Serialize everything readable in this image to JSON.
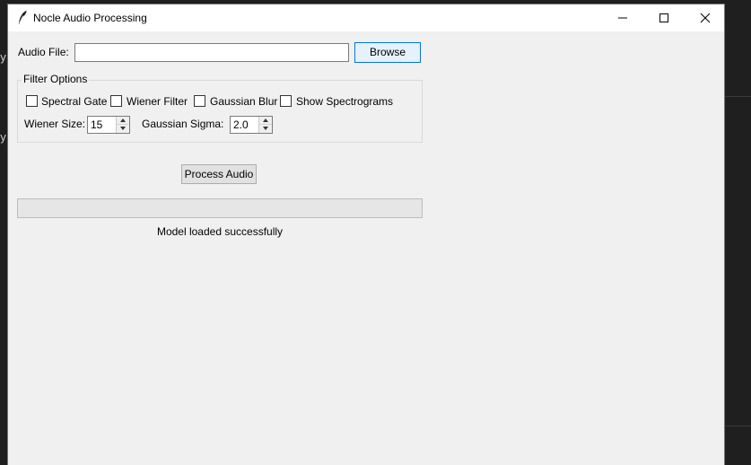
{
  "window": {
    "title": "Nocle Audio Processing",
    "icon": "feather-icon"
  },
  "titlebar_buttons": {
    "minimize": "minimize-icon",
    "maximize": "maximize-icon",
    "close": "close-icon"
  },
  "audio_file": {
    "label": "Audio File:",
    "value": "",
    "browse_label": "Browse"
  },
  "filter_options": {
    "title": "Filter Options",
    "checkboxes": [
      {
        "label": "Spectral Gate",
        "checked": false
      },
      {
        "label": "Wiener Filter",
        "checked": false
      },
      {
        "label": "Gaussian Blur",
        "checked": false
      },
      {
        "label": "Show Spectrograms",
        "checked": false
      }
    ],
    "wiener_size": {
      "label": "Wiener Size:",
      "value": "15"
    },
    "gaussian_sigma": {
      "label": "Gaussian Sigma:",
      "value": "2.0"
    }
  },
  "process_button": "Process Audio",
  "progress": {
    "value": 0
  },
  "status": "Model loaded successfully",
  "colors": {
    "window_bg": "#f0f0f0",
    "accent": "#0078d7",
    "desktop_bg": "#1f1f1f"
  }
}
